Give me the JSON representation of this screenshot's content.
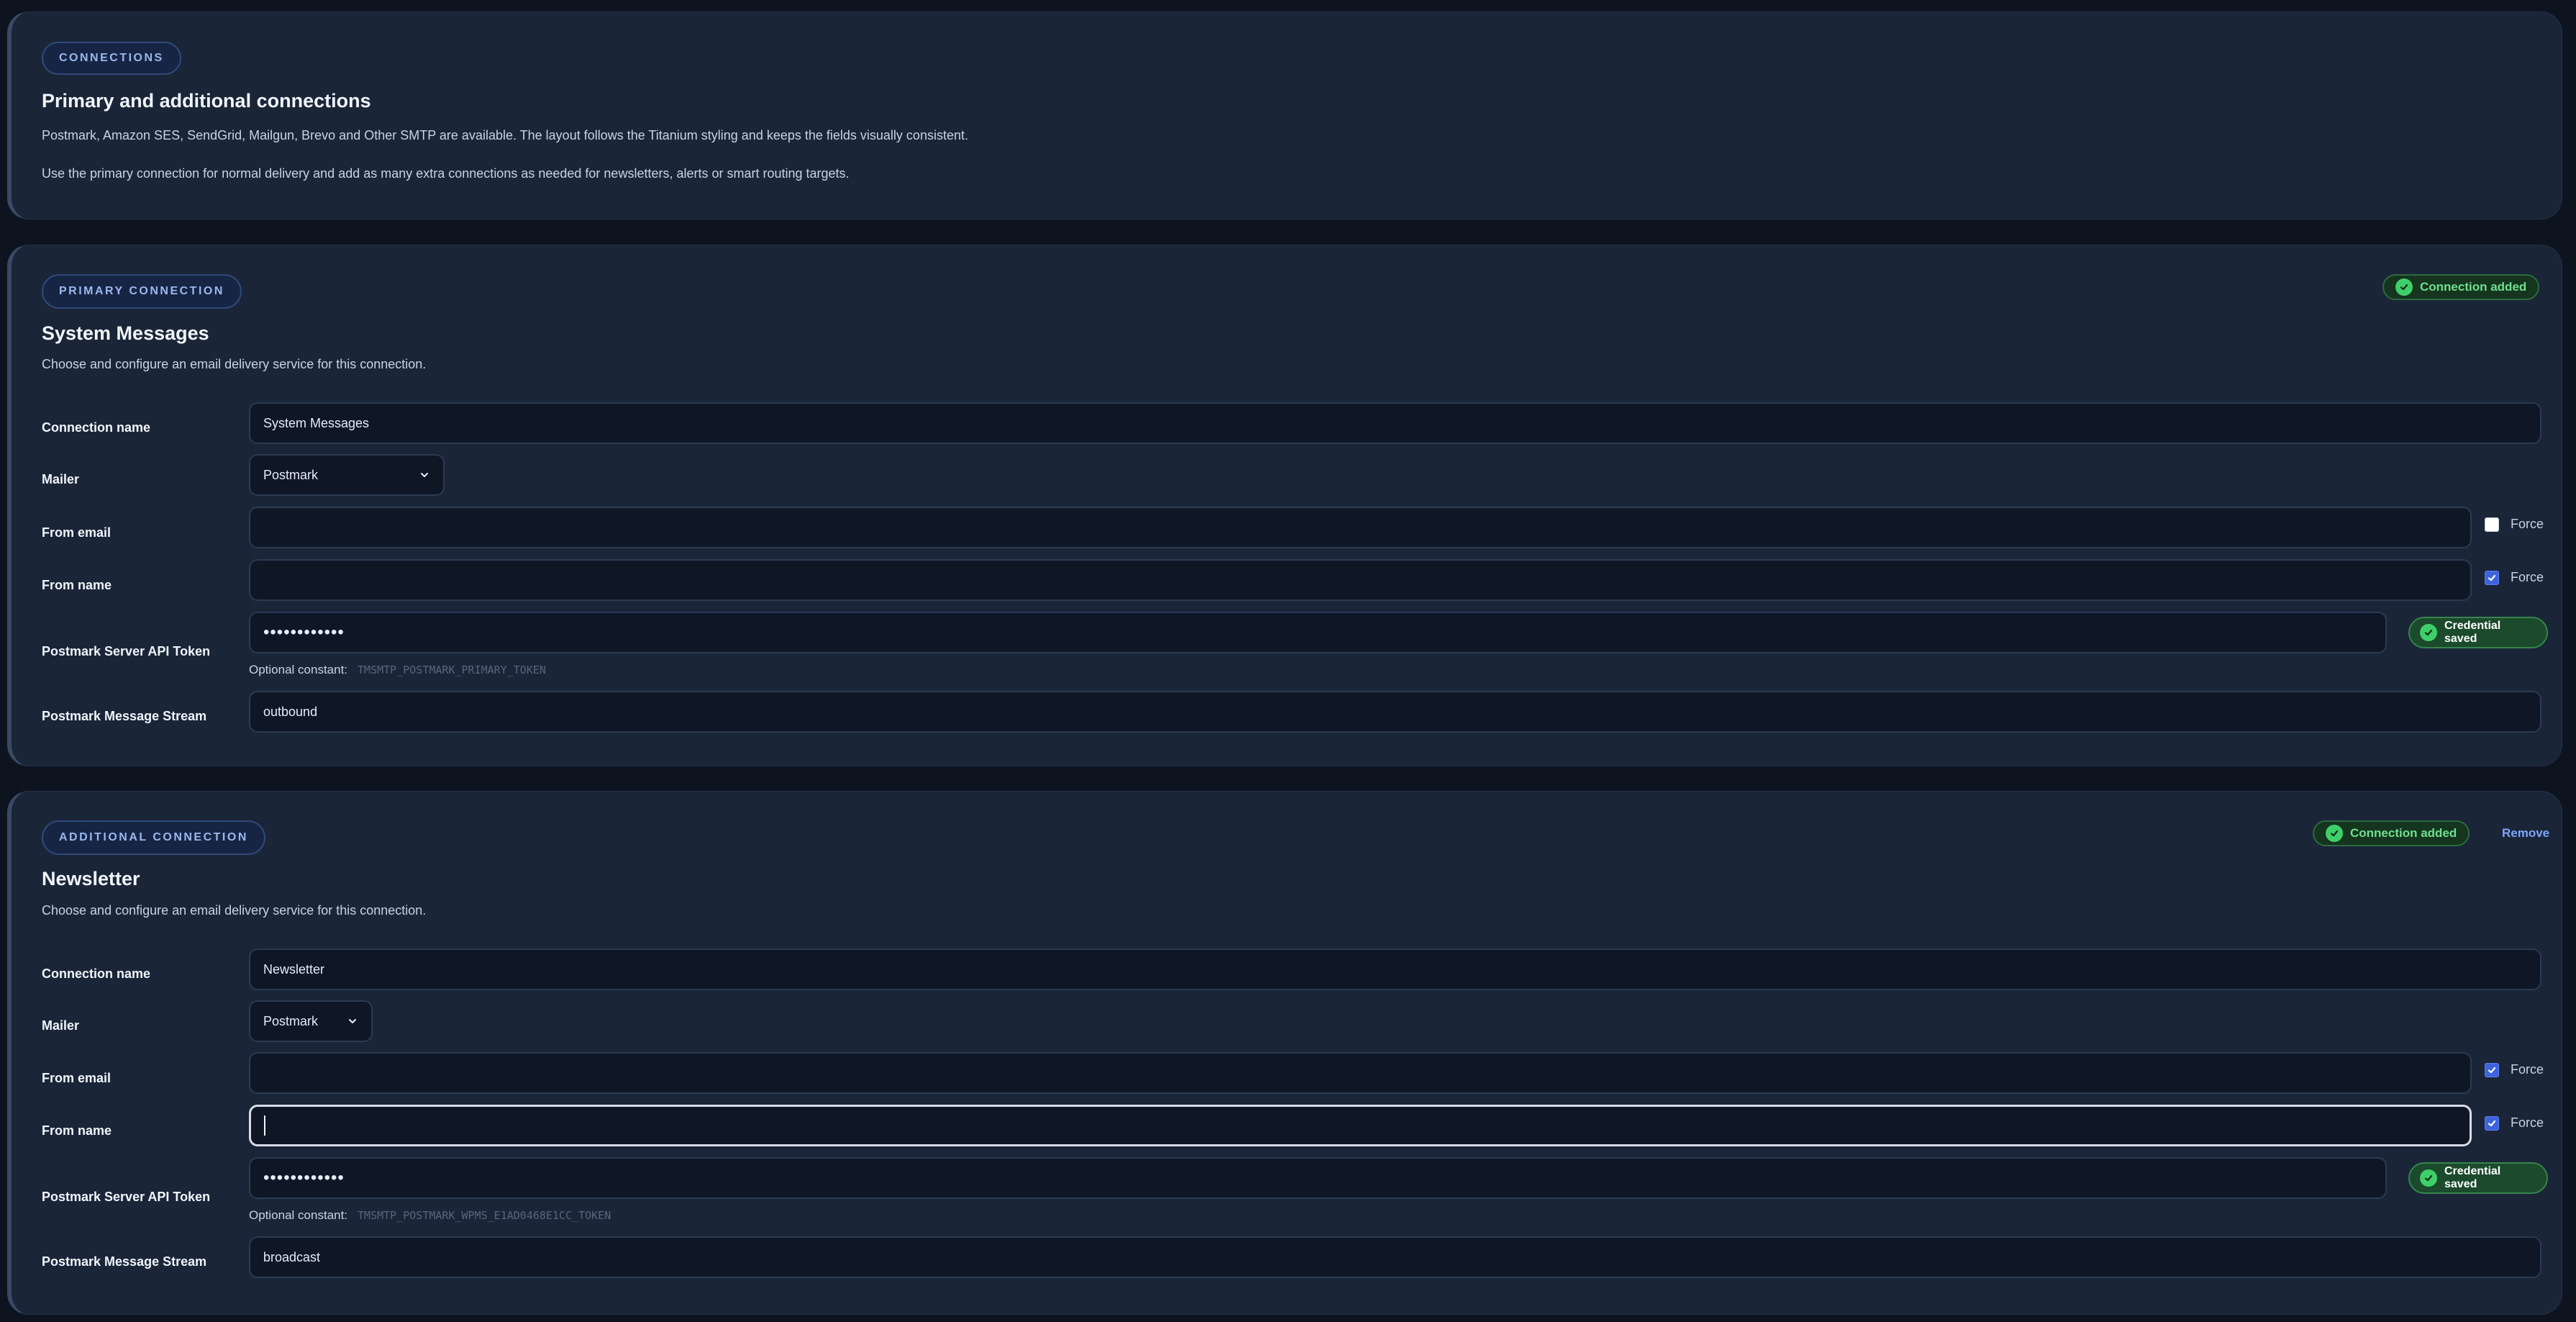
{
  "intro": {
    "pill": "Connections",
    "title": "Primary and additional connections",
    "text1": "Postmark, Amazon SES, SendGrid, Mailgun, Brevo and Other SMTP are available. The layout follows the Titanium styling and keeps the fields visually consistent.",
    "text2": "Use the primary connection for normal delivery and add as many extra connections as needed for newsletters, alerts or smart routing targets."
  },
  "primary": {
    "pill": "Primary connection",
    "status": "Connection added",
    "title": "System Messages",
    "desc": "Choose and configure an email delivery service for this connection.",
    "labels": {
      "name": "Connection name",
      "mailer": "Mailer",
      "from_email": "From email",
      "from_name": "From name",
      "token": "Postmark Server API Token",
      "stream": "Postmark Message Stream"
    },
    "name_value": "System Messages",
    "mailer_value": "Postmark",
    "from_email_value": "",
    "from_name_value": "",
    "force_label": "Force",
    "from_email_force": false,
    "from_name_force": true,
    "token_value": "••••••••••••",
    "cred": "Credential saved",
    "optional_label": "Optional constant:",
    "optional_const": "TMSMTP_POSTMARK_PRIMARY_TOKEN",
    "stream_value": "outbound"
  },
  "additional": {
    "pill": "Additional connection",
    "status": "Connection added",
    "remove": "Remove",
    "title": "Newsletter",
    "desc": "Choose and configure an email delivery service for this connection.",
    "labels": {
      "name": "Connection name",
      "mailer": "Mailer",
      "from_email": "From email",
      "from_name": "From name",
      "token": "Postmark Server API Token",
      "stream": "Postmark Message Stream"
    },
    "name_value": "Newsletter",
    "mailer_value": "Postmark",
    "from_email_value": "",
    "from_name_value": "",
    "force_label": "Force",
    "from_email_force": true,
    "from_name_force": true,
    "token_value": "••••••••••••",
    "cred": "Credential saved",
    "optional_label": "Optional constant:",
    "optional_const": "TMSMTP_POSTMARK_WPMS_E1AD0468E1CC_TOKEN",
    "stream_value": "broadcast"
  },
  "colors": {
    "accent": "#3e63dd",
    "success": "#3fcf6a",
    "card": "#1a2538",
    "background": "#0d1420"
  },
  "icons": [
    "check-circle-icon",
    "chevron-down-icon",
    "checkbox-checked-icon"
  ]
}
